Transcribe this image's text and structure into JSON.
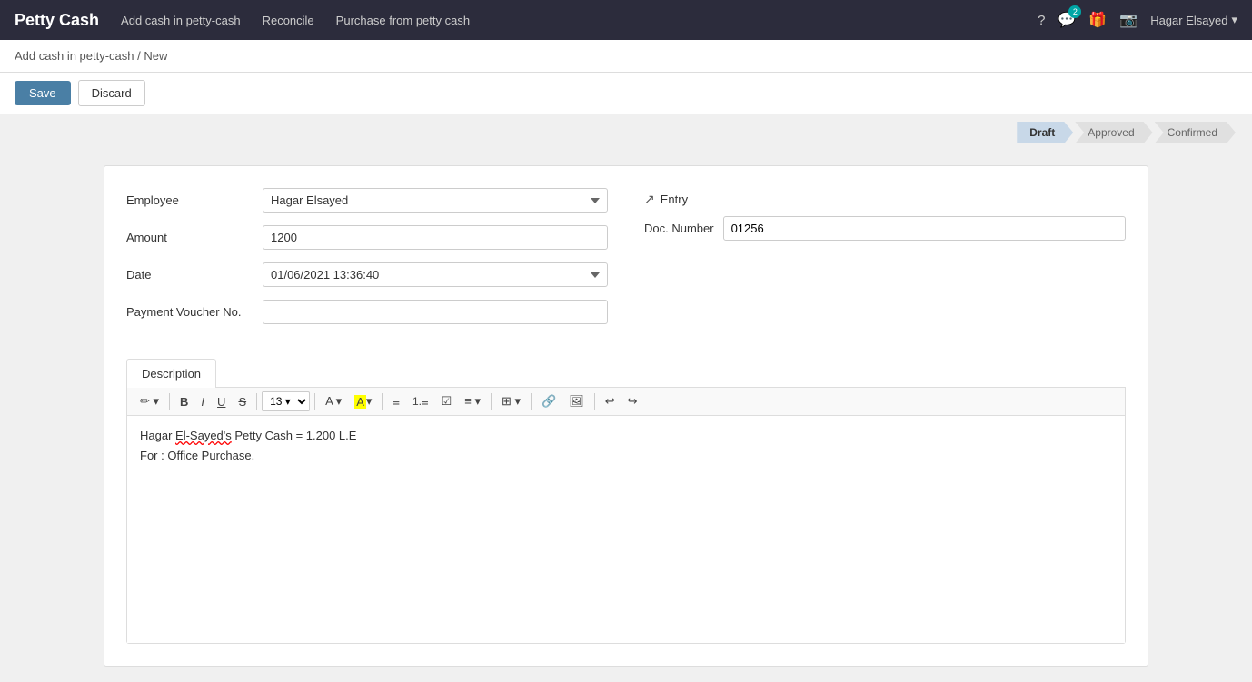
{
  "app": {
    "title": "Petty Cash"
  },
  "nav": {
    "links": [
      {
        "label": "Add cash in petty-cash",
        "id": "add-cash"
      },
      {
        "label": "Reconcile",
        "id": "reconcile"
      },
      {
        "label": "Purchase from petty cash",
        "id": "purchase"
      }
    ],
    "icons": {
      "help": "?",
      "messages": "💬",
      "messages_badge": "2",
      "gift": "🎁",
      "camera": "📷"
    },
    "user": "Hagar Elsayed"
  },
  "breadcrumb": {
    "text": "Add cash in petty-cash / New"
  },
  "actions": {
    "save": "Save",
    "discard": "Discard"
  },
  "status": {
    "steps": [
      {
        "label": "Draft",
        "active": true
      },
      {
        "label": "Approved",
        "active": false
      },
      {
        "label": "Confirmed",
        "active": false
      }
    ]
  },
  "form": {
    "employee_label": "Employee",
    "employee_value": "Hagar Elsayed",
    "amount_label": "Amount",
    "amount_value": "1200",
    "date_label": "Date",
    "date_value": "01/06/2021 13:36:40",
    "payment_voucher_label": "Payment Voucher No.",
    "payment_voucher_value": "",
    "entry_label": "Entry",
    "doc_number_label": "Doc. Number",
    "doc_number_value": "01256"
  },
  "description": {
    "tab_label": "Description",
    "toolbar": {
      "format_btn": "✏",
      "bold": "B",
      "italic": "I",
      "underline": "U",
      "strikethrough": "S̶",
      "font_size": "13",
      "font_color": "A",
      "highlight": "A",
      "bullet_list": "☰",
      "ordered_list": "☰",
      "checklist": "☑",
      "align": "≡",
      "table": "⊞",
      "link": "🔗",
      "image": "🖼",
      "undo": "↩",
      "redo": "↪"
    },
    "content_line1": "Hagar El-Sayed's Petty Cash = 1.200 L.E",
    "content_line2": "For : Office Purchase."
  }
}
